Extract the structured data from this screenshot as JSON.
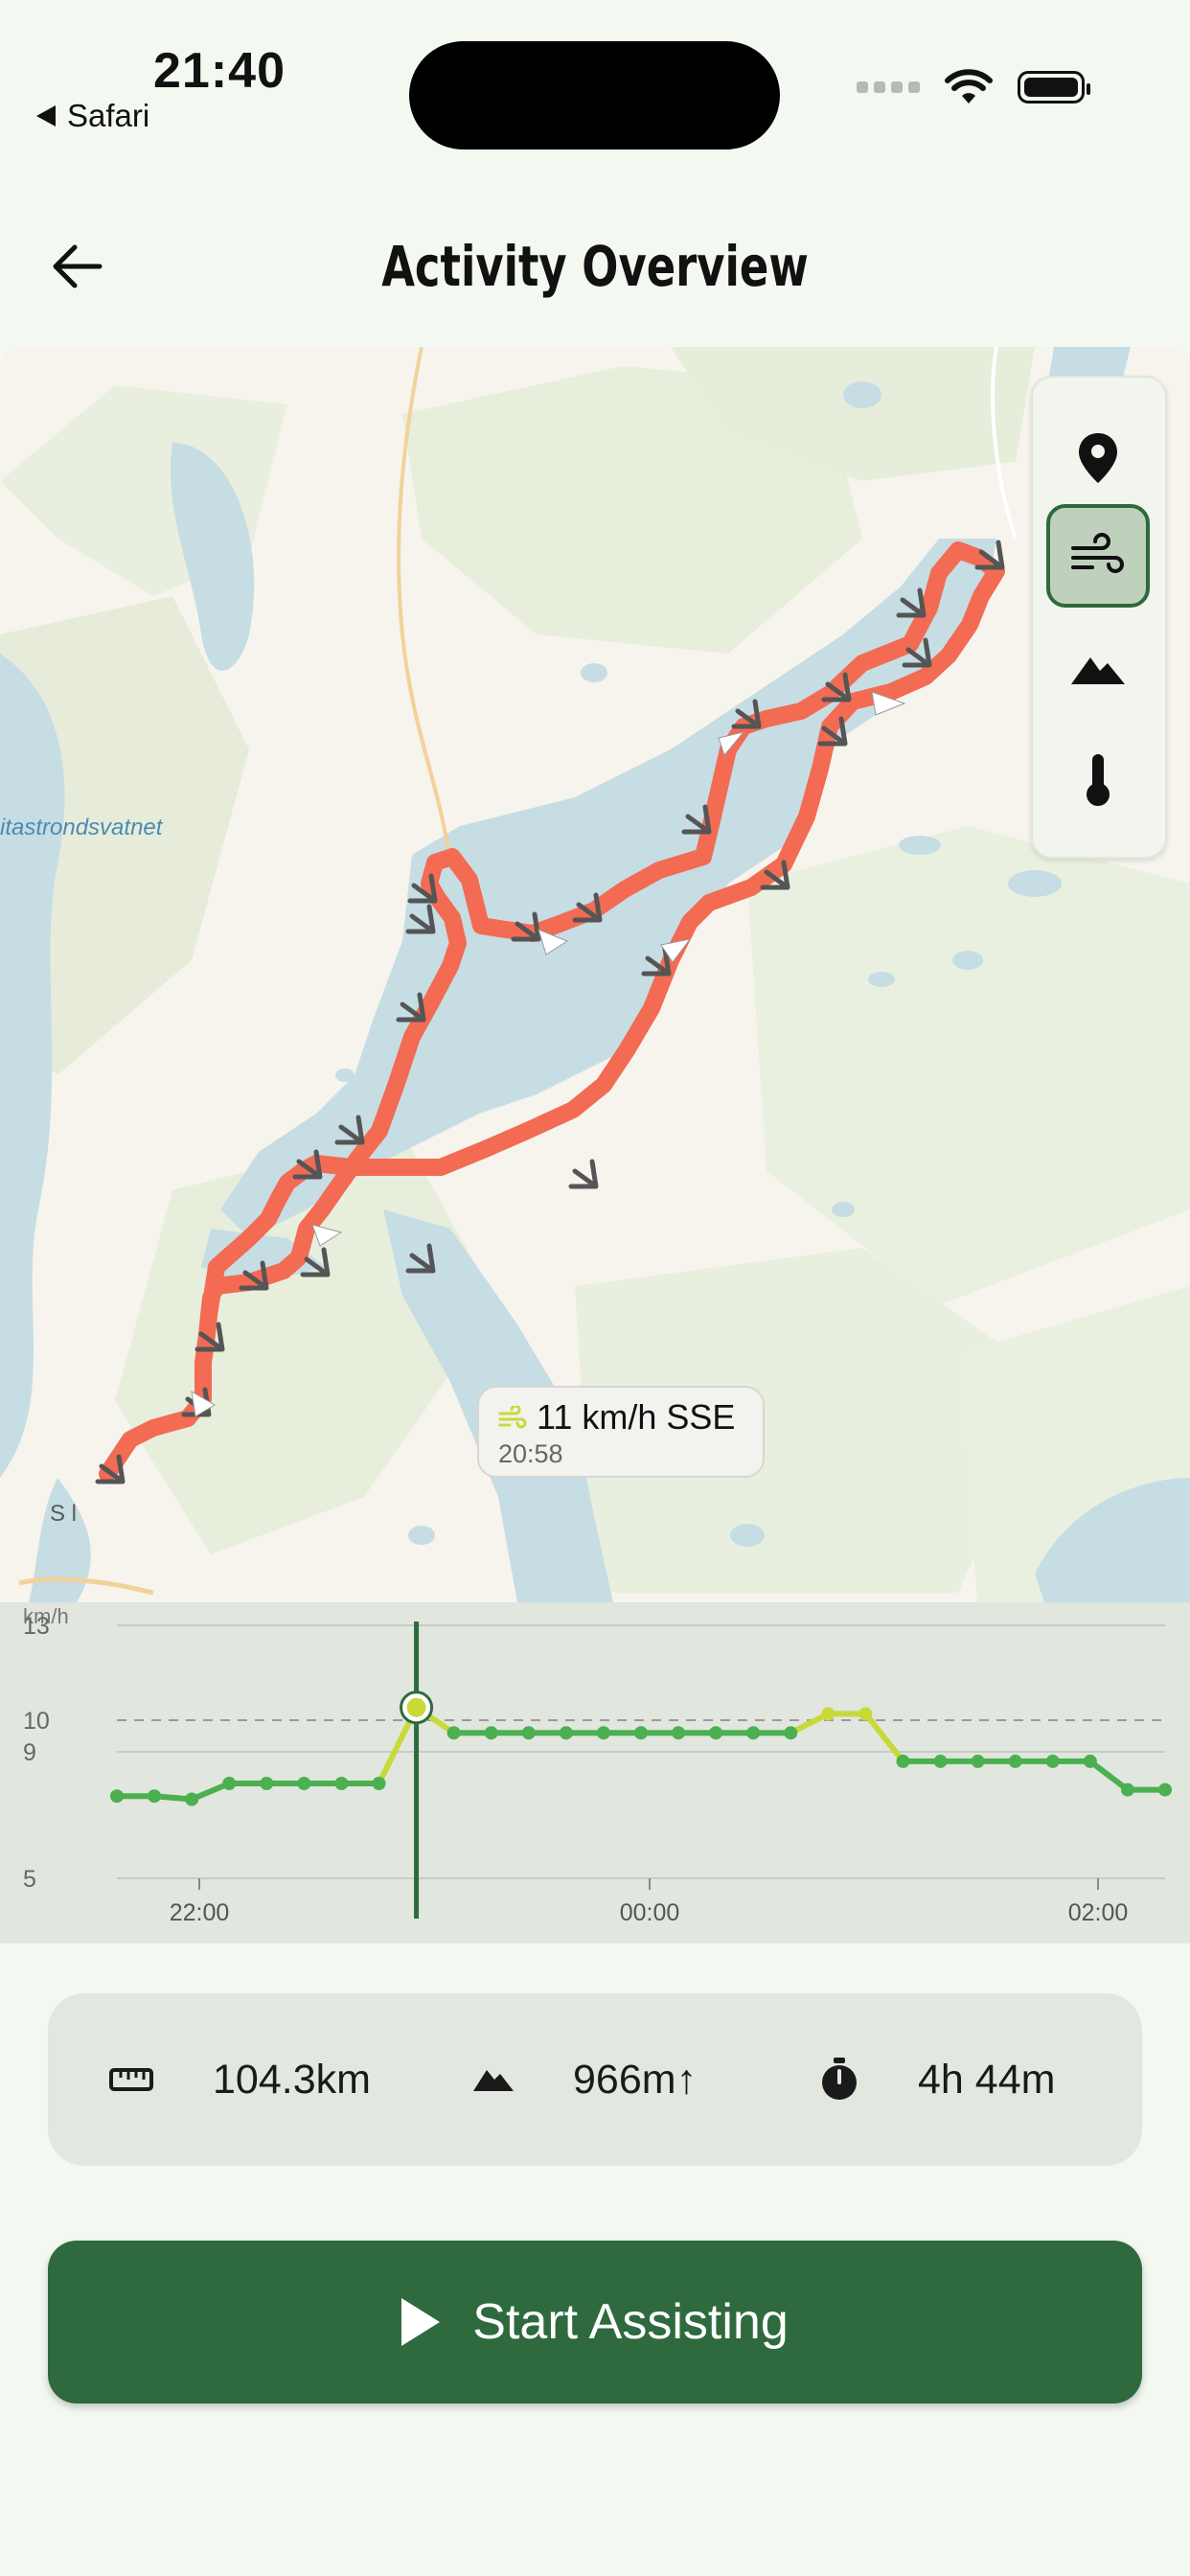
{
  "status_bar": {
    "time": "21:40",
    "back_app": "Safari"
  },
  "header": {
    "title": "Activity Overview"
  },
  "map": {
    "lake_label": "itastrondsvatnet",
    "place_label": "S               l",
    "layers": [
      {
        "icon": "location-pin-icon",
        "active": false
      },
      {
        "icon": "wind-icon",
        "active": true
      },
      {
        "icon": "mountain-icon",
        "active": false
      },
      {
        "icon": "thermometer-icon",
        "active": false
      }
    ],
    "tooltip": {
      "speed": "11 km/h SSE",
      "time": "20:58"
    }
  },
  "chart_data": {
    "type": "line",
    "ylabel": "km/h",
    "yticks": [
      "13",
      "10",
      "9",
      "5"
    ],
    "xticks": [
      "22:00",
      "00:00",
      "02:00"
    ],
    "ylim": [
      5,
      13
    ],
    "reference_line": 10,
    "selected_time": "20:58",
    "series": [
      {
        "values": [
          7.6,
          7.6,
          7.5,
          8.0,
          8.0,
          8.0,
          8.0,
          8.0,
          10.4,
          9.6,
          9.6,
          9.6,
          9.6,
          9.6,
          9.6,
          9.6,
          9.6,
          9.6,
          9.6,
          10.2,
          10.2,
          8.7,
          8.7,
          8.7,
          8.7,
          8.7,
          8.7,
          7.8,
          7.8
        ]
      }
    ],
    "highlight_color": "#c9d93a",
    "line_color": "#4caf50"
  },
  "stats": {
    "distance": "104.3km",
    "elevation": "966m↑",
    "duration": "4h 44m"
  },
  "cta": {
    "label": "Start Assisting"
  },
  "colors": {
    "accent": "#2e6a3e",
    "route": "#f26b52",
    "water": "#c6dde4"
  }
}
